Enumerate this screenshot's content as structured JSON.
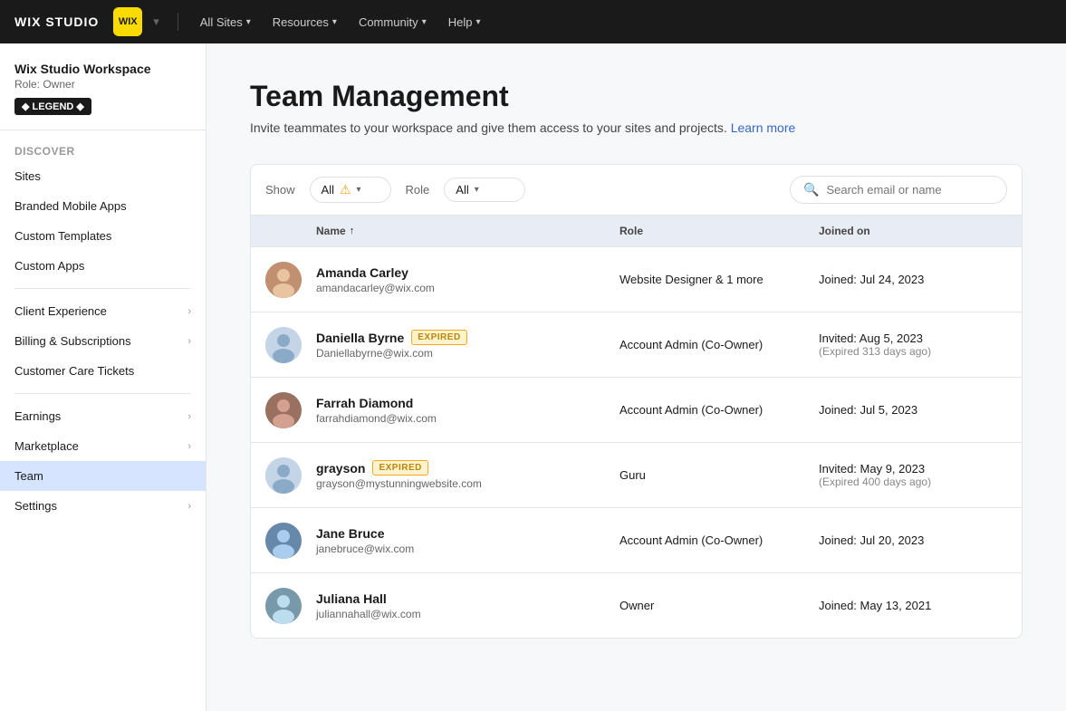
{
  "topnav": {
    "brand": "WIX STUDIO",
    "logo_text": "WIX",
    "dropdown_arrow": "▾",
    "all_sites_label": "All Sites",
    "resources_label": "Resources",
    "community_label": "Community",
    "help_label": "Help"
  },
  "sidebar": {
    "workspace_name": "Wix Studio Workspace",
    "workspace_role": "Role: Owner",
    "badge_label": "◆ LEGEND ◆",
    "discover_label": "Discover",
    "items": [
      {
        "id": "sites",
        "label": "Sites",
        "has_chevron": false
      },
      {
        "id": "branded-mobile-apps",
        "label": "Branded Mobile Apps",
        "has_chevron": false
      },
      {
        "id": "custom-templates",
        "label": "Custom Templates",
        "has_chevron": false
      },
      {
        "id": "custom-apps",
        "label": "Custom Apps",
        "has_chevron": false
      },
      {
        "id": "client-experience",
        "label": "Client Experience",
        "has_chevron": true
      },
      {
        "id": "billing-subscriptions",
        "label": "Billing & Subscriptions",
        "has_chevron": true
      },
      {
        "id": "customer-care-tickets",
        "label": "Customer Care Tickets",
        "has_chevron": false
      },
      {
        "id": "earnings",
        "label": "Earnings",
        "has_chevron": true
      },
      {
        "id": "marketplace",
        "label": "Marketplace",
        "has_chevron": true
      },
      {
        "id": "team",
        "label": "Team",
        "has_chevron": false,
        "active": true
      },
      {
        "id": "settings",
        "label": "Settings",
        "has_chevron": true
      }
    ]
  },
  "page": {
    "title": "Team Management",
    "subtitle": "Invite teammates to your workspace and give them access to your sites and projects.",
    "learn_more": "Learn more"
  },
  "filter_bar": {
    "show_label": "Show",
    "show_value": "All",
    "has_warning": true,
    "role_label": "Role",
    "role_value": "All",
    "search_placeholder": "Search email or name"
  },
  "table": {
    "columns": [
      {
        "id": "avatar",
        "label": ""
      },
      {
        "id": "name",
        "label": "Name",
        "sorted": "asc"
      },
      {
        "id": "role",
        "label": "Role"
      },
      {
        "id": "joined",
        "label": "Joined on"
      }
    ],
    "rows": [
      {
        "id": "amanda",
        "name": "Amanda Carley",
        "email": "amandacarley@wix.com",
        "role": "Website Designer & 1 more",
        "joined": "Joined: Jul 24, 2023",
        "joined_sub": "",
        "expired": false,
        "avatar_emoji": "👩"
      },
      {
        "id": "daniella",
        "name": "Daniella Byrne",
        "email": "Daniellabyrne@wix.com",
        "role": "Account Admin (Co-Owner)",
        "joined": "Invited: Aug 5, 2023",
        "joined_sub": "(Expired 313 days ago)",
        "expired": true,
        "avatar_emoji": "👤"
      },
      {
        "id": "farrah",
        "name": "Farrah Diamond",
        "email": "farrahdiamond@wix.com",
        "role": "Account Admin (Co-Owner)",
        "joined": "Joined: Jul 5, 2023",
        "joined_sub": "",
        "expired": false,
        "avatar_emoji": "👩"
      },
      {
        "id": "grayson",
        "name": "grayson",
        "email": "grayson@mystunningwebsite.com",
        "role": "Guru",
        "joined": "Invited: May 9, 2023",
        "joined_sub": "(Expired 400 days ago)",
        "expired": true,
        "avatar_emoji": "👤"
      },
      {
        "id": "jane",
        "name": "Jane Bruce",
        "email": "janebruce@wix.com",
        "role": "Account Admin (Co-Owner)",
        "joined": "Joined: Jul 20, 2023",
        "joined_sub": "",
        "expired": false,
        "avatar_emoji": "👩"
      },
      {
        "id": "juliana",
        "name": "Juliana Hall",
        "email": "juliannahall@wix.com",
        "role": "Owner",
        "joined": "Joined: May 13, 2021",
        "joined_sub": "",
        "expired": false,
        "avatar_emoji": "👩"
      }
    ],
    "expired_label": "EXPIRED"
  }
}
